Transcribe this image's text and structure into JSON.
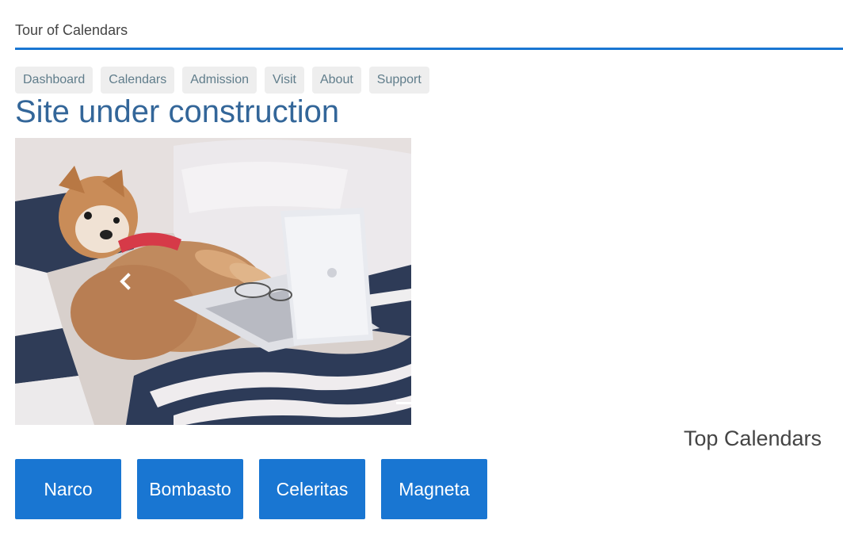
{
  "app": {
    "title": "Tour of Calendars"
  },
  "nav": {
    "items": [
      {
        "label": "Dashboard"
      },
      {
        "label": "Calendars"
      },
      {
        "label": "Admission"
      },
      {
        "label": "Visit"
      },
      {
        "label": "About"
      },
      {
        "label": "Support"
      }
    ]
  },
  "main": {
    "title": "Site under construction",
    "carousel": {
      "image_description_icon": "dog-with-laptop-photo",
      "prev_icon": "chevron-left-icon"
    }
  },
  "top_calendars": {
    "heading": "Top Calendars",
    "items": [
      {
        "name": "Narco"
      },
      {
        "name": "Bombasto"
      },
      {
        "name": "Celeritas"
      },
      {
        "name": "Magneta"
      }
    ]
  },
  "colors": {
    "accent": "#1976d2",
    "title": "#336699",
    "nav_bg": "#eeeeee",
    "nav_text": "#607d8b"
  }
}
